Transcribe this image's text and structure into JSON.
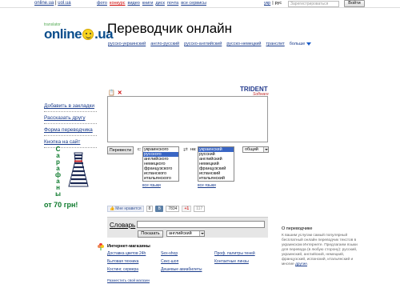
{
  "topbar": {
    "home_links": [
      "online.ua",
      "uol.ua"
    ],
    "services": [
      {
        "label": "фото",
        "active": false
      },
      {
        "label": "конкурс",
        "active": true
      },
      {
        "label": "видео",
        "active": false
      },
      {
        "label": "книги",
        "active": false
      },
      {
        "label": "диск",
        "active": false
      },
      {
        "label": "почта",
        "active": false
      },
      {
        "label": "все сервисы",
        "active": false
      }
    ],
    "languages": [
      "укр",
      "рус"
    ],
    "register_placeholder": "Зарегистрироваться",
    "login_label": "Войти"
  },
  "logo": {
    "tagline": "translator",
    "word_left": "online",
    "word_right": ".ua"
  },
  "page_title": "Переводчик онлайн",
  "tabs": {
    "items": [
      "русско-украинский",
      "англо-русский",
      "русско-английский",
      "русско-немецкий",
      "транслит"
    ],
    "more_label": "больше"
  },
  "sidebar": {
    "links": [
      "Добавить в закладки",
      "Рассказать другу",
      "Форма переводчика",
      "Кнопка на сайт"
    ]
  },
  "ad": {
    "text": "Сарафаны",
    "price": "от 70 грн!"
  },
  "translator": {
    "brand": "TRIDENT",
    "brand_sub": "Software",
    "translate_label": "Перевести",
    "from_label": "с:",
    "to_label": "на:",
    "from_languages": [
      "украинского",
      "русского",
      "английского",
      "немецкого",
      "французского",
      "испанского",
      "итальянского"
    ],
    "from_selected": 1,
    "to_languages": [
      "украинский",
      "русский",
      "английский",
      "немецкий",
      "французский",
      "испанский",
      "итальянский"
    ],
    "to_selected": 0,
    "topic_value": "общий",
    "all_languages_label": "все языки"
  },
  "social": {
    "fb_label": "Мне нравится",
    "fb_count": "8",
    "vk_count": "7834",
    "g_label": "+1",
    "g_count": "117"
  },
  "dictionary": {
    "title": "Словарь",
    "show_label": "Показать",
    "language_value": "английский"
  },
  "shops": {
    "title": "Интернет-магазины",
    "items": [
      "Доставка цветов 24h",
      "Sex-shop",
      "Проф. палитры теней",
      "Бытовая техника",
      "Секс-шоп",
      "Контактные линзы",
      "Костинг, сервера",
      "Дешевые авиабилеты",
      ""
    ],
    "add_label": "Разместить свой магазин"
  },
  "about": {
    "title": "О переводчике",
    "text": "К вашим услугам самый популярный бесплатный онлайн переводчик текстов в украинском Интернете. Предлагаем языки для перевода (в любую сторону): русский, украинский, английский, немецкий, французский, испанский, итальянский и многие",
    "link": "другие"
  }
}
